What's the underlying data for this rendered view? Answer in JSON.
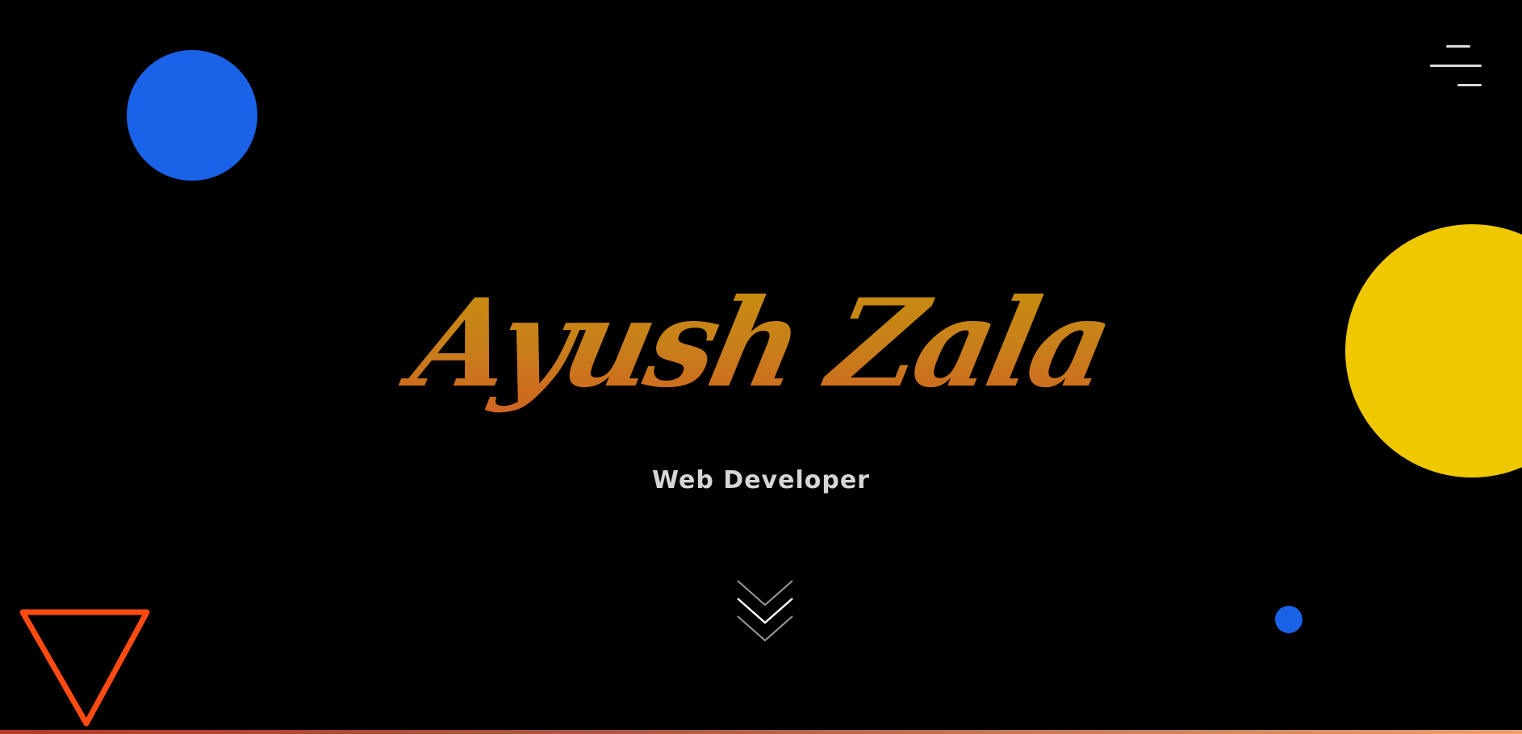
{
  "hero": {
    "title": "Ayush Zala",
    "subtitle": "Web Developer"
  },
  "icons": {
    "menu": "hamburger-menu-icon",
    "scroll": "chevron-down-triple-icon"
  },
  "colors": {
    "background": "#000000",
    "blue": "#1a62e8",
    "yellow": "#f0c800",
    "orange": "#ff4a12",
    "title_gradient_top": "#c49a00",
    "title_gradient_bottom": "#d44e26",
    "subtitle": "#d6d6d6"
  }
}
